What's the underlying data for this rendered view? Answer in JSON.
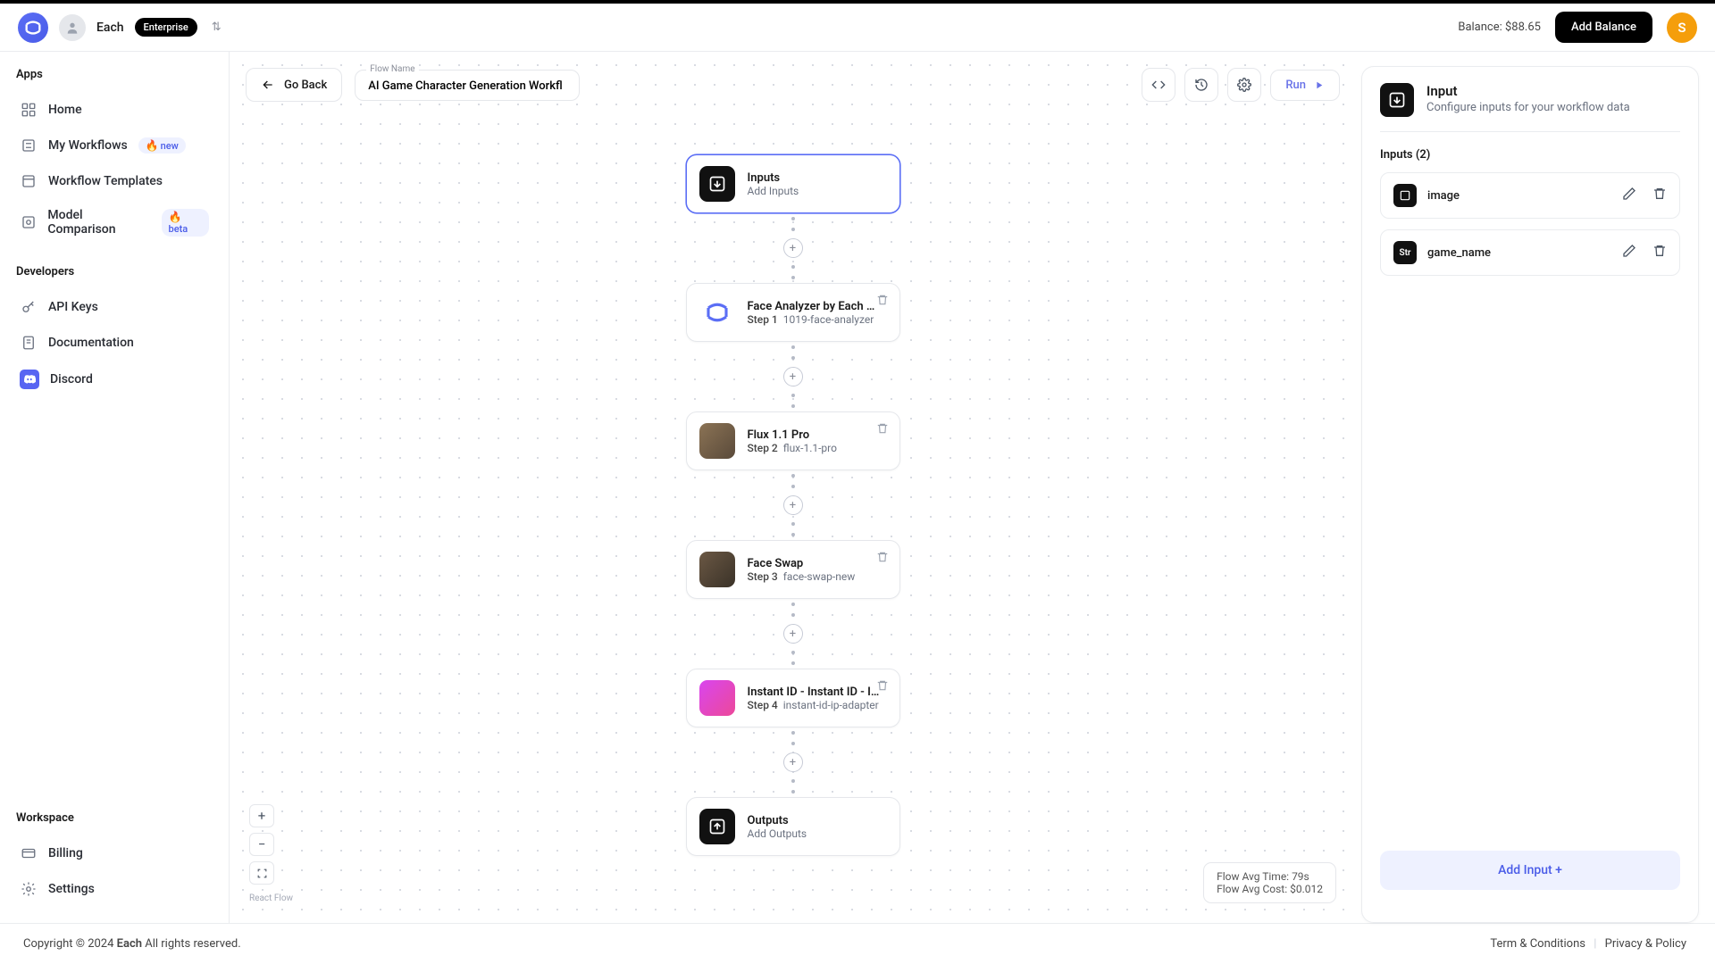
{
  "header": {
    "org": "Each",
    "tier": "Enterprise",
    "balance_label": "Balance: $88.65",
    "add_balance": "Add Balance",
    "avatar": "S"
  },
  "sidebar": {
    "apps_title": "Apps",
    "dev_title": "Developers",
    "workspace_title": "Workspace",
    "items": {
      "home": "Home",
      "my_workflows": "My Workflows",
      "my_workflows_badge": "new",
      "workflow_templates": "Workflow Templates",
      "model_comparison": "Model Comparison",
      "model_comparison_badge": "beta",
      "api_keys": "API Keys",
      "documentation": "Documentation",
      "discord": "Discord",
      "billing": "Billing",
      "settings": "Settings"
    }
  },
  "canvas": {
    "go_back": "Go Back",
    "flowname_label": "Flow Name",
    "flowname_value": "AI Game Character Generation Workfl",
    "run": "Run",
    "react_flow": "React Flow",
    "stats_time": "Flow Avg Time: 79s",
    "stats_cost": "Flow Avg Cost: $0.012",
    "nodes": {
      "inputs_title": "Inputs",
      "inputs_sub": "Add Inputs",
      "step1_title": "Face Analyzer by Each AI by",
      "step1_step": "Step 1",
      "step1_slug": "1019-face-analyzer",
      "step2_title": "Flux 1.1 Pro",
      "step2_step": "Step 2",
      "step2_slug": "flux-1.1-pro",
      "step3_title": "Face Swap",
      "step3_step": "Step 3",
      "step3_slug": "face-swap-new",
      "step4_title": "Instant ID - Instant ID - Ins",
      "step4_step": "Step 4",
      "step4_slug": "instant-id-ip-adapter",
      "outputs_title": "Outputs",
      "outputs_sub": "Add Outputs"
    }
  },
  "panel": {
    "title": "Input",
    "desc": "Configure inputs for your workflow data",
    "section": "Inputs (2)",
    "rows": [
      {
        "type": "□",
        "name": "image"
      },
      {
        "type": "Str",
        "name": "game_name"
      }
    ],
    "add_input": "Add Input +"
  },
  "footer": {
    "copyright_pre": "Copyright © 2024 ",
    "copyright_b": "Each",
    "copyright_post": " All rights reserved.",
    "terms": "Term & Conditions",
    "privacy": "Privacy & Policy"
  }
}
